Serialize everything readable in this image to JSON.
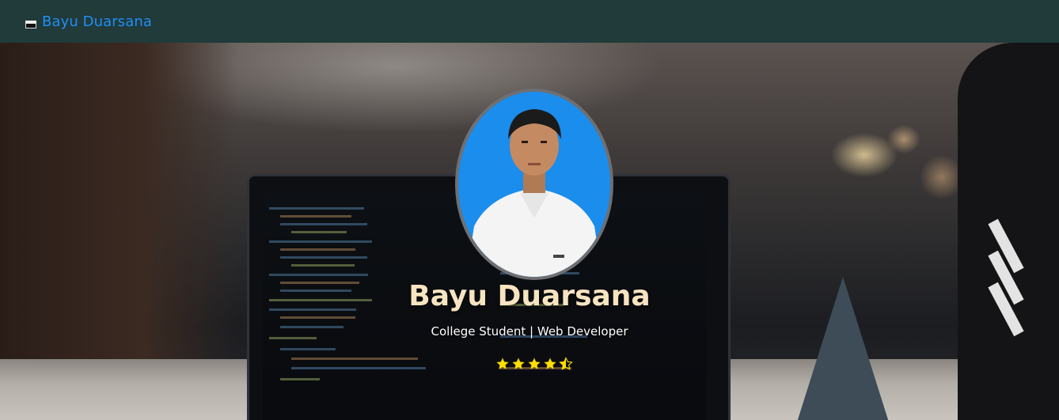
{
  "navbar": {
    "brand_label": "Bayu Duarsana",
    "brand_icon": "broken-image-icon",
    "background_color": "#213a3a",
    "link_color": "#1f8ff5"
  },
  "hero": {
    "name": "Bayu Duarsana",
    "subtitle": "College Student | Web Developer",
    "rating": 4.5,
    "rating_max": 5,
    "name_color": "#f7e4c0",
    "star_color": "#ffe000",
    "avatar": "profile-photo"
  }
}
